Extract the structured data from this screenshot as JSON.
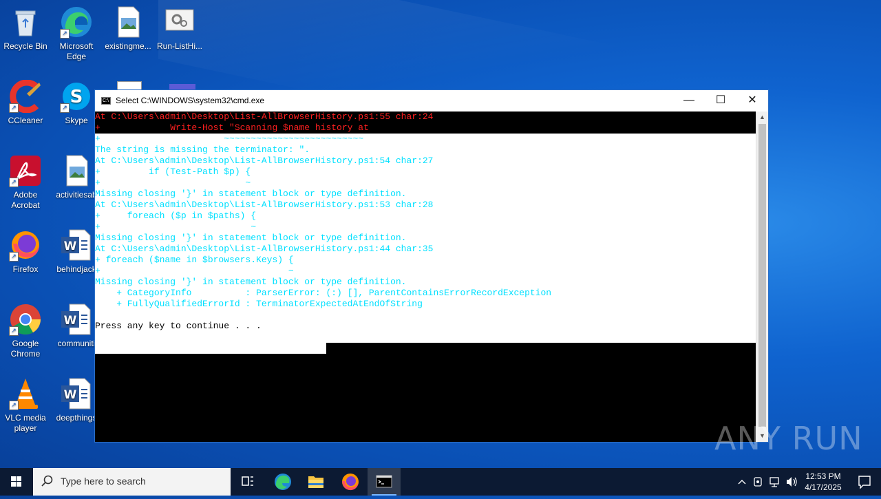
{
  "desktop": {
    "icons": [
      {
        "label": "Recycle Bin"
      },
      {
        "label": "Microsoft Edge"
      },
      {
        "label": "existingme..."
      },
      {
        "label": "Run-ListHi..."
      },
      {
        "label": "CCleaner"
      },
      {
        "label": "Skype"
      },
      {
        "label": "Adobe Acrobat"
      },
      {
        "label": "activitiesab"
      },
      {
        "label": "Firefox"
      },
      {
        "label": "behindjack"
      },
      {
        "label": "Google Chrome"
      },
      {
        "label": "communiti"
      },
      {
        "label": "VLC media player"
      },
      {
        "label": "deepthings"
      }
    ]
  },
  "window": {
    "title": "Select C:\\WINDOWS\\system32\\cmd.exe",
    "minimize": "—",
    "maximize": "☐",
    "close": "✕"
  },
  "console": {
    "lines": [
      "At C:\\Users\\admin\\Desktop\\List-AllBrowserHistory.ps1:55 char:24",
      "+             Write-Host \"Scanning $name history at",
      "+                       ~~~~~~~~~~~~~~~~~~~~~~~~~~",
      "The string is missing the terminator: \".",
      "At C:\\Users\\admin\\Desktop\\List-AllBrowserHistory.ps1:54 char:27",
      "+         if (Test-Path $p) {",
      "+                           ~",
      "Missing closing '}' in statement block or type definition.",
      "At C:\\Users\\admin\\Desktop\\List-AllBrowserHistory.ps1:53 char:28",
      "+     foreach ($p in $paths) {",
      "+                            ~",
      "Missing closing '}' in statement block or type definition.",
      "At C:\\Users\\admin\\Desktop\\List-AllBrowserHistory.ps1:44 char:35",
      "+ foreach ($name in $browsers.Keys) {",
      "+                                   ~",
      "Missing closing '}' in statement block or type definition.",
      "    + CategoryInfo          : ParserError: (:) [], ParentContainsErrorRecordException",
      "    + FullyQualifiedErrorId : TerminatorExpectedAtEndOfString",
      "",
      "Press any key to continue . . ."
    ],
    "colors": {
      "error_red": "#ff2020",
      "cyan": "#00e0ff",
      "selected_bg": "#ffffff",
      "default_fg": "#000000"
    }
  },
  "watermark": "ANY RUN",
  "taskbar": {
    "search_placeholder": "Type here to search",
    "time": "12:53 PM",
    "date": "4/17/2025"
  }
}
